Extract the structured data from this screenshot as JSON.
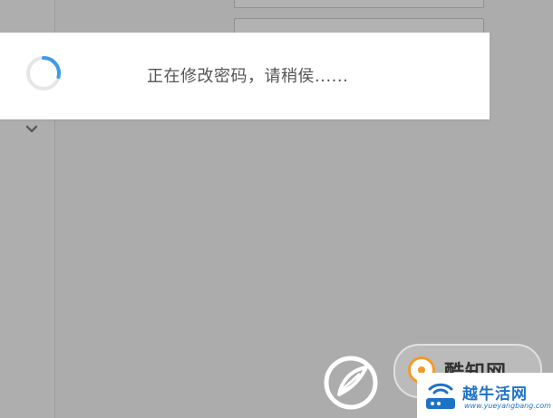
{
  "loading": {
    "message": "正在修改密码，请稍侯......"
  },
  "watermarks": {
    "badge_text": "酷知网",
    "corner_title": "越牛活网",
    "corner_url": "www.yueyangbang.com"
  },
  "colors": {
    "overlay": "#acacac",
    "spinner_accent": "#3d9be9",
    "spinner_track": "#e6e6e6",
    "message_text": "#555555",
    "badge_accent": "#f39a2a",
    "logo_blue": "#1e72c6"
  },
  "icons": {
    "spinner": "loading-spinner-icon",
    "sidebar": "chevron-down-icon",
    "badge": "kuzhi-logo-icon",
    "corner": "router-logo-icon",
    "watermark": "leaf-logo-icon"
  }
}
